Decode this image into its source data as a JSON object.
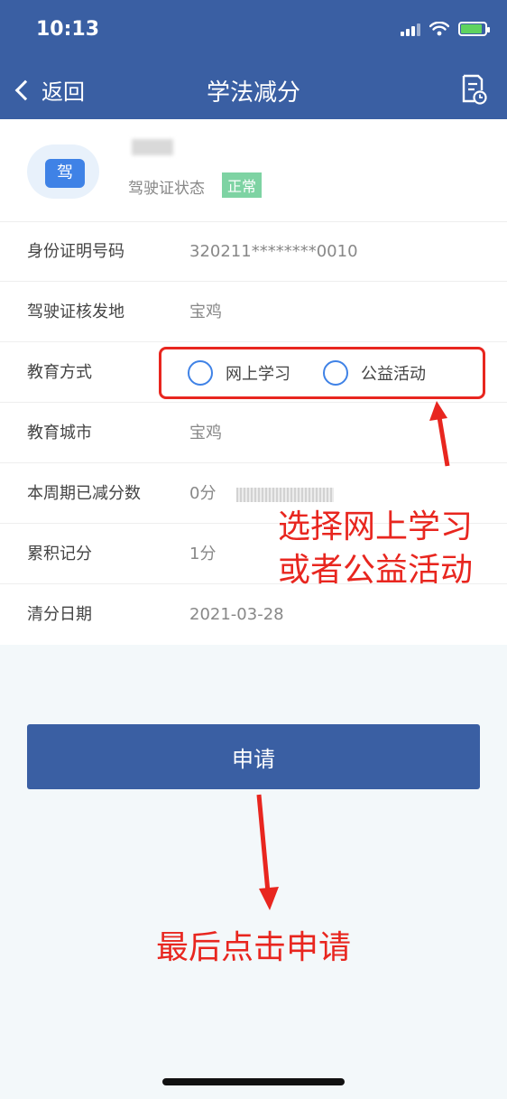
{
  "status_bar": {
    "time": "10:13"
  },
  "nav": {
    "back_label": "返回",
    "title": "学法减分"
  },
  "profile": {
    "avatar_text": "驾",
    "license_status_label": "驾驶证状态",
    "license_status_badge": "正常"
  },
  "fields": {
    "id_number": {
      "label": "身份证明号码",
      "value": "320211********0010"
    },
    "issue_place": {
      "label": "驾驶证核发地",
      "value": "宝鸡"
    },
    "education_method": {
      "label": "教育方式",
      "options": [
        "网上学习",
        "公益活动"
      ]
    },
    "education_city": {
      "label": "教育城市",
      "value": "宝鸡"
    },
    "period_deducted": {
      "label": "本周期已减分数",
      "value": "0分"
    },
    "accumulated_points": {
      "label": "累积记分",
      "value": "1分"
    },
    "clear_date": {
      "label": "清分日期",
      "value": "2021-03-28"
    }
  },
  "apply_button": "申请",
  "annotations": {
    "choose_method_line1": "选择网上学习",
    "choose_method_line2": "或者公益活动",
    "final_step": "最后点击申请"
  },
  "colors": {
    "nav_bg": "#3a5fa3",
    "accent": "#3f82e6",
    "badge": "#7ed3a3",
    "annotation": "#e8261f"
  }
}
